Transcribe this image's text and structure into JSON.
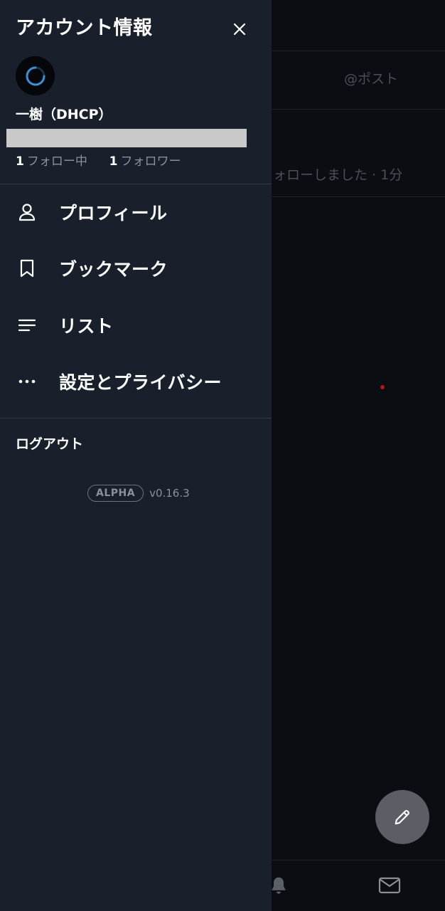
{
  "background": {
    "tab_post_label": "@ポスト",
    "notification_text": "ォローしました · 1分",
    "compose_icon": "pencil-icon",
    "bottom_nav_icons": [
      "bell-icon",
      "mail-icon"
    ]
  },
  "drawer": {
    "title": "アカウント情報",
    "close_icon": "close-icon",
    "account": {
      "display_name": "一樹（DHCP）",
      "following_count": "1",
      "following_label": "フォロー中",
      "followers_count": "1",
      "followers_label": "フォロワー"
    },
    "menu": [
      {
        "label": "プロフィール",
        "icon": "person-icon"
      },
      {
        "label": "ブックマーク",
        "icon": "bookmark-icon"
      },
      {
        "label": "リスト",
        "icon": "list-icon"
      },
      {
        "label": "設定とプライバシー",
        "icon": "more-icon"
      }
    ],
    "logout_label": "ログアウト",
    "badge_label": "ALPHA",
    "version": "v0.16.3"
  },
  "colors": {
    "drawer_bg": "#19202b",
    "app_bg": "#0b0d12",
    "muted_text": "#8b919b",
    "accent_spinner": "#3a8fd6"
  }
}
